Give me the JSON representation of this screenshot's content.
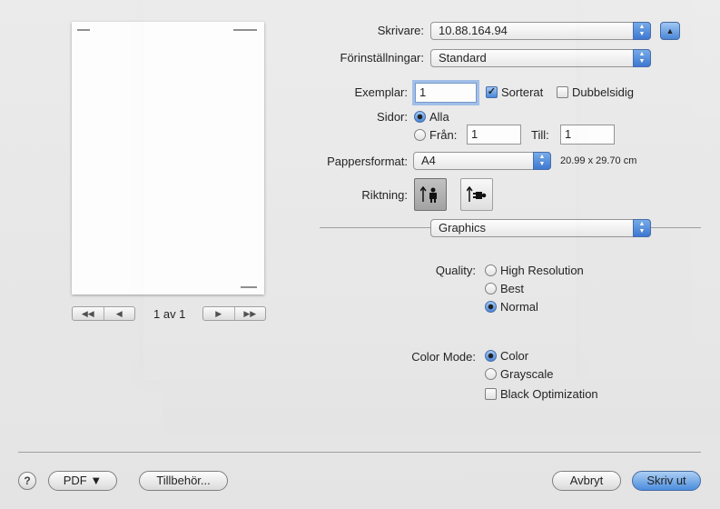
{
  "printer": {
    "label": "Skrivare:",
    "value": "10.88.164.94"
  },
  "presets": {
    "label": "Förinställningar:",
    "value": "Standard"
  },
  "copies": {
    "label": "Exemplar:",
    "value": "1",
    "collated_label": "Sorterat",
    "collated": true,
    "duplex_label": "Dubbelsidig",
    "duplex": false
  },
  "pages": {
    "label": "Sidor:",
    "all_label": "Alla",
    "from_label": "Från:",
    "from_value": "1",
    "to_label": "Till:",
    "to_value": "1"
  },
  "paper": {
    "label": "Pappersformat:",
    "value": "A4",
    "size_text": "20.99 x 29.70 cm"
  },
  "orientation": {
    "label": "Riktning:"
  },
  "section": {
    "value": "Graphics"
  },
  "quality": {
    "label": "Quality:",
    "options": [
      "High Resolution",
      "Best",
      "Normal"
    ],
    "selected": "Normal"
  },
  "color_mode": {
    "label": "Color Mode:",
    "options": [
      "Color",
      "Grayscale"
    ],
    "selected": "Color",
    "black_opt_label": "Black Optimization",
    "black_opt": false
  },
  "preview": {
    "page_indicator": "1 av 1"
  },
  "footer": {
    "help": "?",
    "pdf_label": "PDF ▼",
    "accessories_label": "Tillbehör...",
    "cancel_label": "Avbryt",
    "print_label": "Skriv ut"
  },
  "colors": {
    "accent": "#3d7fd6",
    "sheet_bg": "#e8e8e8"
  }
}
